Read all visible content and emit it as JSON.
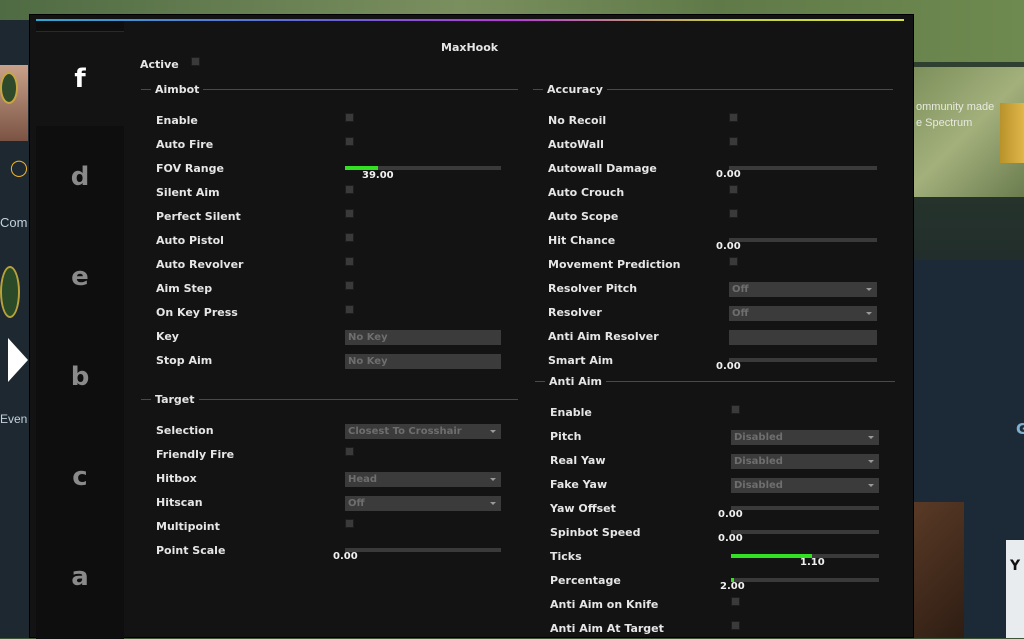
{
  "background": {
    "banner_lines": [
      "ommunity made",
      "e Spectrum"
    ],
    "left_com": "Com",
    "left_even": "Even",
    "right_g": "G",
    "right_card_letter": "Y"
  },
  "menu": {
    "title": "MaxHook",
    "tabs": [
      "f",
      "d",
      "e",
      "b",
      "c",
      "a"
    ],
    "active_label": "Active",
    "aimbot": {
      "header": "Aimbot",
      "enable": "Enable",
      "auto_fire": "Auto Fire",
      "fov_range": "FOV Range",
      "fov_value": "39.00",
      "fov_fraction": 0.21,
      "silent_aim": "Silent Aim",
      "perfect_silent": "Perfect Silent",
      "auto_pistol": "Auto Pistol",
      "auto_revolver": "Auto Revolver",
      "aim_step": "Aim Step",
      "on_key_press": "On Key Press",
      "key": "Key",
      "key_value": "No Key",
      "stop_aim": "Stop Aim",
      "stop_aim_value": "No Key"
    },
    "target": {
      "header": "Target",
      "selection": "Selection",
      "selection_value": "Closest To Crosshair",
      "friendly_fire": "Friendly Fire",
      "hitbox": "Hitbox",
      "hitbox_value": "Head",
      "hitscan": "Hitscan",
      "hitscan_value": "Off",
      "multipoint": "Multipoint",
      "point_scale": "Point Scale",
      "point_scale_value": "0.00"
    },
    "accuracy": {
      "header": "Accuracy",
      "no_recoil": "No Recoil",
      "autowall": "AutoWall",
      "autowall_damage": "Autowall Damage",
      "autowall_damage_value": "0.00",
      "auto_crouch": "Auto Crouch",
      "auto_scope": "Auto Scope",
      "hit_chance": "Hit Chance",
      "hit_chance_value": "0.00",
      "movement_prediction": "Movement Prediction",
      "resolver_pitch": "Resolver Pitch",
      "resolver_pitch_value": "Off",
      "resolver": "Resolver",
      "resolver_value": "Off",
      "anti_aim_resolver": "Anti Aim Resolver",
      "smart_aim": "Smart Aim",
      "smart_aim_value": "0.00"
    },
    "anti_aim": {
      "header": "Anti Aim",
      "enable": "Enable",
      "pitch": "Pitch",
      "pitch_value": "Disabled",
      "real_yaw": "Real Yaw",
      "real_yaw_value": "Disabled",
      "fake_yaw": "Fake Yaw",
      "fake_yaw_value": "Disabled",
      "yaw_offset": "Yaw Offset",
      "yaw_offset_value": "0.00",
      "spinbot_speed": "Spinbot Speed",
      "spinbot_speed_value": "0.00",
      "ticks": "Ticks",
      "ticks_value": "1.10",
      "ticks_fraction": 0.55,
      "percentage": "Percentage",
      "percentage_value": "2.00",
      "percentage_fraction": 0.02,
      "anti_aim_on_knife": "Anti Aim on Knife",
      "anti_aim_at_target": "Anti Aim At Target"
    },
    "colors": {
      "accent_green": "#34e023",
      "panel": "#131313",
      "tab_bar": "#0e0e0e"
    }
  }
}
